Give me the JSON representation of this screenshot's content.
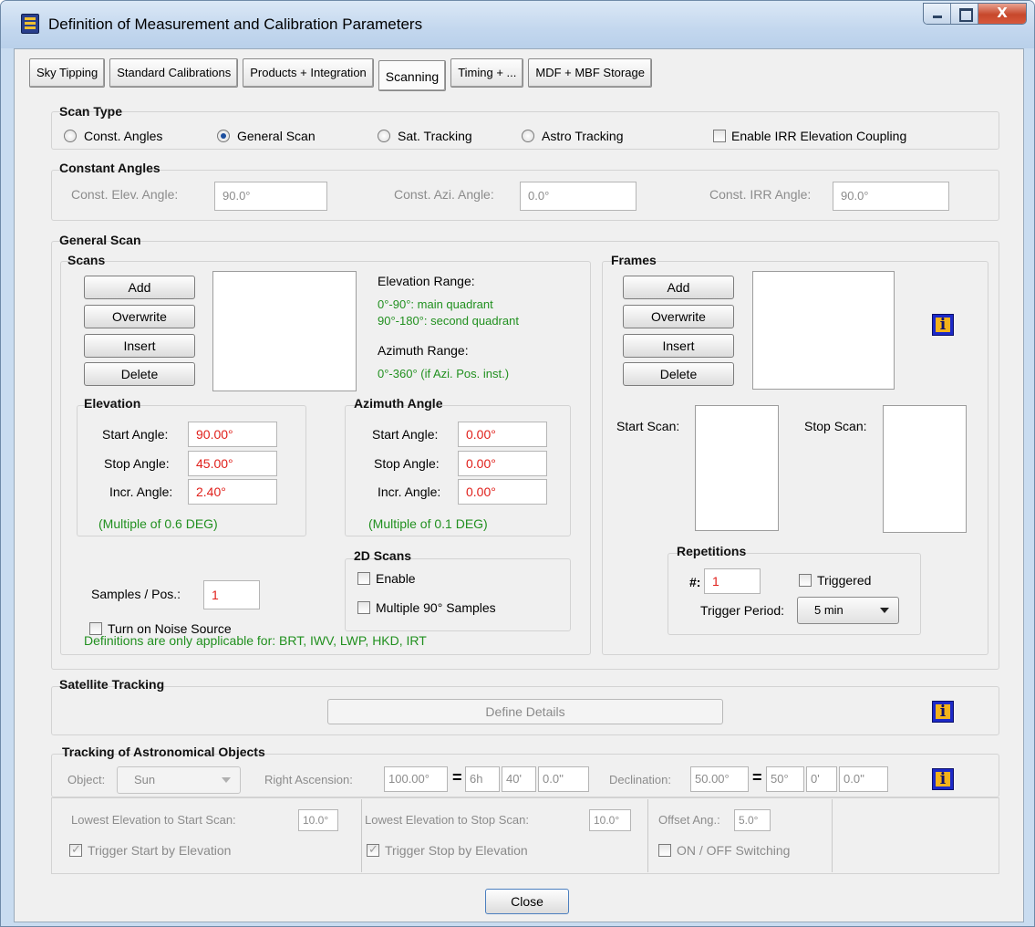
{
  "window": {
    "title": "Definition of Measurement and Calibration Parameters"
  },
  "tabs": [
    "Sky Tipping",
    "Standard Calibrations",
    "Products + Integration",
    "Scanning",
    "Timing + ...",
    "MDF + MBF Storage"
  ],
  "scan_type": {
    "title": "Scan Type",
    "options": [
      "Const. Angles",
      "General Scan",
      "Sat. Tracking",
      "Astro Tracking"
    ],
    "selected": "General Scan",
    "irr_coupling_label": "Enable IRR Elevation Coupling"
  },
  "constant_angles": {
    "title": "Constant Angles",
    "elev_label": "Const. Elev. Angle:",
    "elev_value": "90.0°",
    "azi_label": "Const. Azi. Angle:",
    "azi_value": "0.0°",
    "irr_label": "Const. IRR Angle:",
    "irr_value": "90.0°"
  },
  "general_scan": {
    "title": "General Scan",
    "scans": {
      "title": "Scans",
      "buttons": [
        "Add",
        "Overwrite",
        "Insert",
        "Delete"
      ],
      "elev_range_label": "Elevation Range:",
      "elev_range_line1": "0°-90°: main quadrant",
      "elev_range_line2": "90°-180°: second quadrant",
      "azi_range_label": "Azimuth Range:",
      "azi_range_text": "0°-360° (if Azi. Pos. inst.)"
    },
    "elevation": {
      "title": "Elevation",
      "start_label": "Start Angle:",
      "start_value": "90.00°",
      "stop_label": "Stop Angle:",
      "stop_value": "45.00°",
      "incr_label": "Incr. Angle:",
      "incr_value": "2.40°",
      "note": "(Multiple of 0.6 DEG)"
    },
    "azimuth": {
      "title": "Azimuth Angle",
      "start_label": "Start Angle:",
      "start_value": "0.00°",
      "stop_label": "Stop Angle:",
      "stop_value": "0.00°",
      "incr_label": "Incr. Angle:",
      "incr_value": "0.00°",
      "note": "(Multiple of 0.1 DEG)"
    },
    "samples_label": "Samples / Pos.:",
    "samples_value": "1",
    "noise_source_label": "Turn on Noise Source",
    "scans_2d": {
      "title": "2D Scans",
      "enable_label": "Enable",
      "multiple_label": "Multiple 90° Samples"
    },
    "definitions_note": "Definitions are only applicable for: BRT, IWV, LWP, HKD, IRT",
    "frames": {
      "title": "Frames",
      "buttons": [
        "Add",
        "Overwrite",
        "Insert",
        "Delete"
      ],
      "start_scan_label": "Start Scan:",
      "stop_scan_label": "Stop Scan:"
    },
    "repetitions": {
      "title": "Repetitions",
      "count_label": "#:",
      "count_value": "1",
      "triggered_label": "Triggered",
      "trigger_period_label": "Trigger Period:",
      "trigger_period_value": "5 min"
    }
  },
  "satellite_tracking": {
    "title": "Satellite Tracking",
    "define_details_label": "Define Details"
  },
  "astro_tracking": {
    "title": "Tracking of Astronomical Objects",
    "object_label": "Object:",
    "object_value": "Sun",
    "ra_label": "Right Ascension:",
    "ra_deg": "100.00°",
    "ra_h": "6h",
    "ra_m": "40'",
    "ra_s": "0.0''",
    "dec_label": "Declination:",
    "dec_deg": "50.00°",
    "dec_d": "50°",
    "dec_m": "0'",
    "dec_s": "0.0''",
    "lowest_start_label": "Lowest Elevation to Start Scan:",
    "lowest_start_value": "10.0°",
    "trigger_start_label": "Trigger Start by Elevation",
    "lowest_stop_label": "Lowest Elevation to Stop Scan:",
    "lowest_stop_value": "10.0°",
    "trigger_stop_label": "Trigger Stop by Elevation",
    "offset_label": "Offset Ang.:",
    "offset_value": "5.0°",
    "onoff_label": "ON / OFF Switching"
  },
  "close_label": "Close"
}
